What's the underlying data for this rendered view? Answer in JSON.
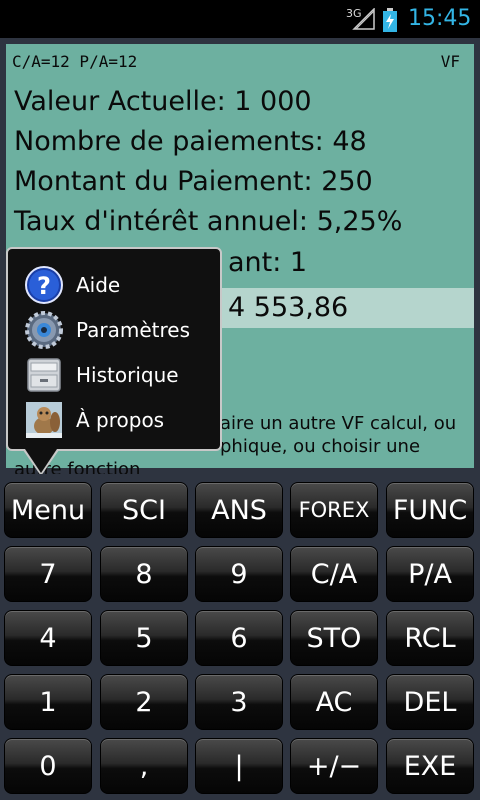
{
  "status_bar": {
    "network": "3G",
    "time": "15:45"
  },
  "display": {
    "mode_left": "C/A=12  P/A=12",
    "mode_right": "VF",
    "lines": [
      "Valeur Actuelle: 1 000",
      "Nombre de paiements: 48",
      "Montant du Paiement: 250",
      "Taux d'intérêt annuel: 5,25%",
      "ant: 1"
    ],
    "result": "4 553,86",
    "hint_line1": "aire un autre VF calcul, ou",
    "hint_line2": "phique, ou choisir une",
    "hint_line3": "autre fonction"
  },
  "menu": {
    "items": [
      {
        "label": "Aide",
        "icon": "help-icon"
      },
      {
        "label": "Paramètres",
        "icon": "gear-icon"
      },
      {
        "label": "Historique",
        "icon": "history-icon"
      },
      {
        "label": "À propos",
        "icon": "about-icon"
      }
    ]
  },
  "keypad": {
    "rows": [
      [
        "Menu",
        "SCI",
        "ANS",
        "FOREX",
        "FUNC"
      ],
      [
        "7",
        "8",
        "9",
        "C/A",
        "P/A"
      ],
      [
        "4",
        "5",
        "6",
        "STO",
        "RCL"
      ],
      [
        "1",
        "2",
        "3",
        "AC",
        "DEL"
      ],
      [
        "0",
        ",",
        "|",
        "+/−",
        "EXE"
      ]
    ]
  },
  "colors": {
    "display_bg": "#6db0a0",
    "result_bg": "#b5d5cd",
    "accent": "#33b5e5"
  }
}
